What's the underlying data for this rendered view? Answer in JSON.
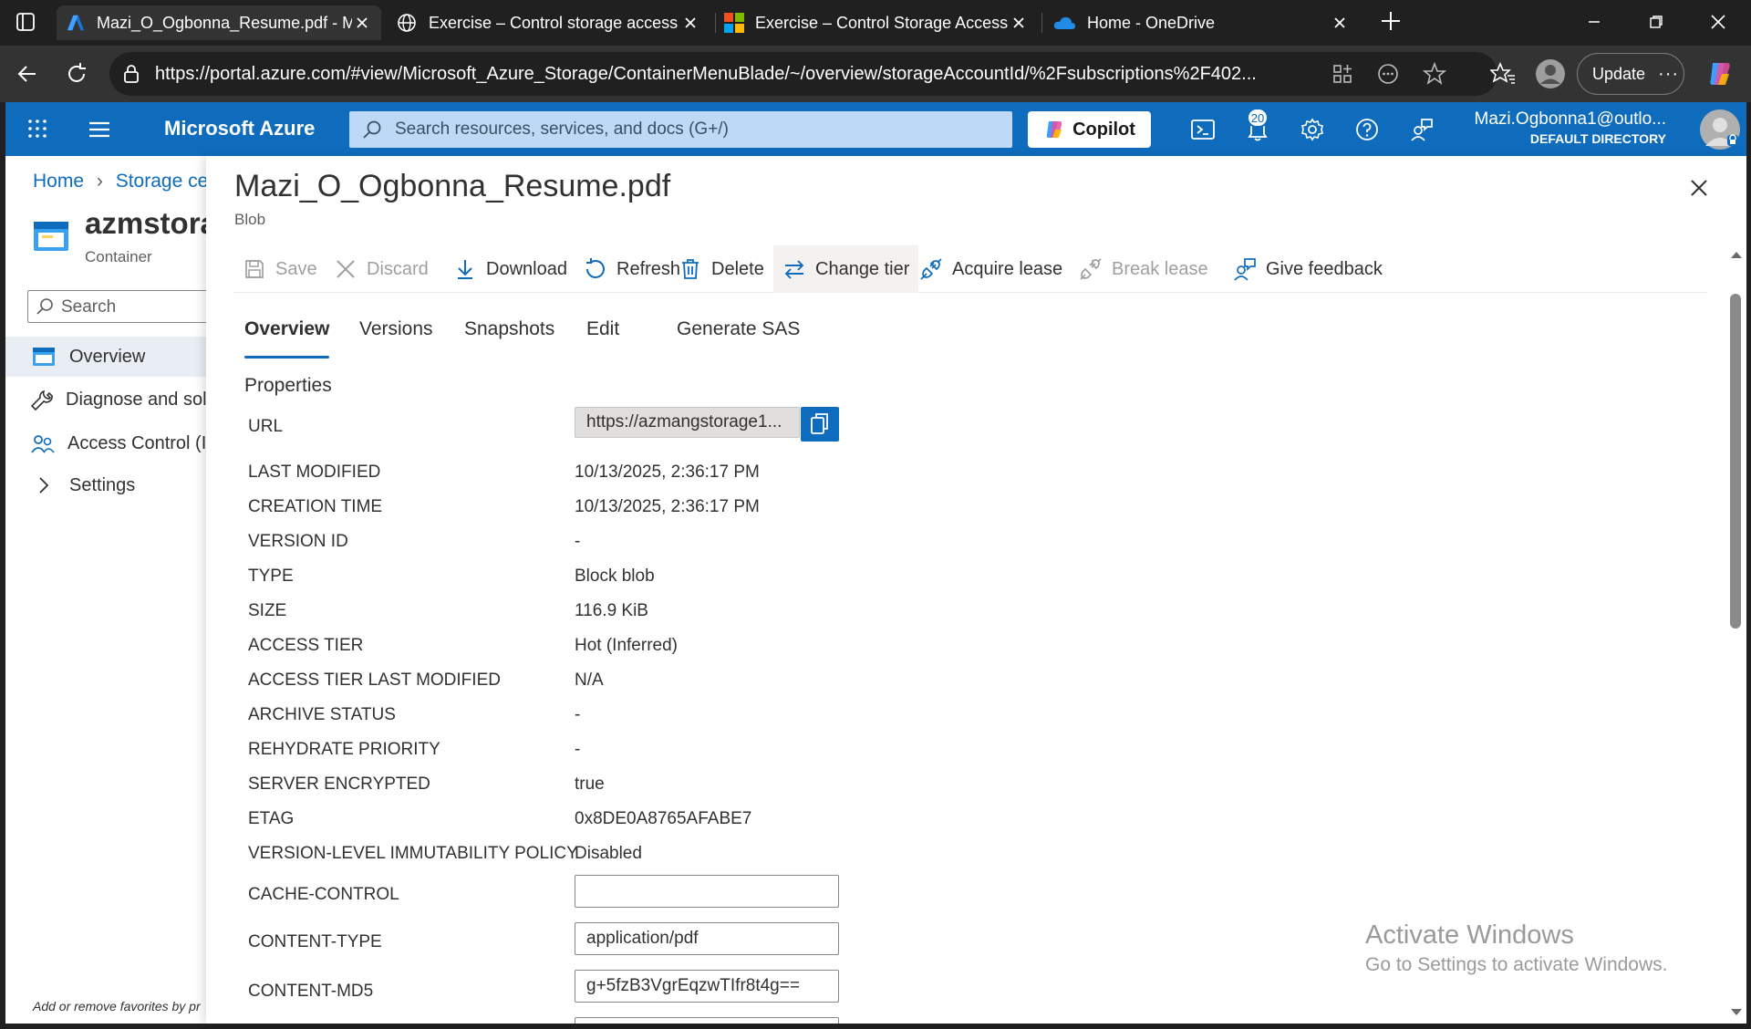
{
  "browser": {
    "tabs": [
      {
        "title": "Mazi_O_Ogbonna_Resume.pdf - Mi",
        "icon": "azure-logo-icon",
        "active": true
      },
      {
        "title": "Exercise – Control storage access",
        "icon": "globe-icon",
        "active": false
      },
      {
        "title": "Exercise – Control Storage Access",
        "icon": "microsoft-logo-icon",
        "active": false
      },
      {
        "title": "Home - OneDrive",
        "icon": "onedrive-icon",
        "active": false
      }
    ],
    "url": "https://portal.azure.com/#view/Microsoft_Azure_Storage/ContainerMenuBlade/~/overview/storageAccountId/%2Fsubscriptions%2F402...",
    "update_label": "Update"
  },
  "azure": {
    "brand": "Microsoft Azure",
    "search_placeholder": "Search resources, services, and docs (G+/)",
    "copilot_label": "Copilot",
    "notification_count": "20",
    "account_email": "Mazi.Ogbonna1@outlo...",
    "account_directory": "DEFAULT DIRECTORY"
  },
  "left": {
    "breadcrumb": {
      "home": "Home",
      "current": "Storage cen"
    },
    "container_name": "azmstora",
    "container_type": "Container",
    "search_placeholder": "Search",
    "nav": [
      {
        "label": "Overview",
        "selected": true
      },
      {
        "label": "Diagnose and solv"
      },
      {
        "label": "Access Control (IA"
      },
      {
        "label": "Settings"
      }
    ],
    "favorites_tip": "Add or remove favorites by pr"
  },
  "blade": {
    "title": "Mazi_O_Ogbonna_Resume.pdf",
    "subtitle": "Blob",
    "toolbar": {
      "save": "Save",
      "discard": "Discard",
      "download": "Download",
      "refresh": "Refresh",
      "delete": "Delete",
      "change_tier": "Change tier",
      "acquire_lease": "Acquire lease",
      "break_lease": "Break lease",
      "give_feedback": "Give feedback"
    },
    "tabs": [
      "Overview",
      "Versions",
      "Snapshots",
      "Edit",
      "Generate SAS"
    ],
    "properties_title": "Properties",
    "props": {
      "url_label": "URL",
      "url_value": "https://azmangstorage1...",
      "last_modified_label": "LAST MODIFIED",
      "last_modified": "10/13/2025, 2:36:17 PM",
      "creation_time_label": "CREATION TIME",
      "creation_time": "10/13/2025, 2:36:17 PM",
      "version_id_label": "VERSION ID",
      "version_id": "-",
      "type_label": "TYPE",
      "type": "Block blob",
      "size_label": "SIZE",
      "size": "116.9 KiB",
      "access_tier_label": "ACCESS TIER",
      "access_tier": "Hot (Inferred)",
      "access_tier_last_modified_label": "ACCESS TIER LAST MODIFIED",
      "access_tier_last_modified": "N/A",
      "archive_status_label": "ARCHIVE STATUS",
      "archive_status": "-",
      "rehydrate_priority_label": "REHYDRATE PRIORITY",
      "rehydrate_priority": "-",
      "server_encrypted_label": "SERVER ENCRYPTED",
      "server_encrypted": "true",
      "etag_label": "ETAG",
      "etag": "0x8DE0A8765AFABE7",
      "immutability_label": "VERSION-LEVEL IMMUTABILITY POLICY",
      "immutability": "Disabled",
      "cache_control_label": "CACHE-CONTROL",
      "cache_control": "",
      "content_type_label": "CONTENT-TYPE",
      "content_type": "application/pdf",
      "content_md5_label": "CONTENT-MD5",
      "content_md5": "g+5fzB3VgrEqzwTIfr8t4g=="
    }
  },
  "watermark": {
    "line1": "Activate Windows",
    "line2": "Go to Settings to activate Windows."
  },
  "colors": {
    "azure_blue": "#0f6cbd",
    "browser_dark": "#202020"
  }
}
